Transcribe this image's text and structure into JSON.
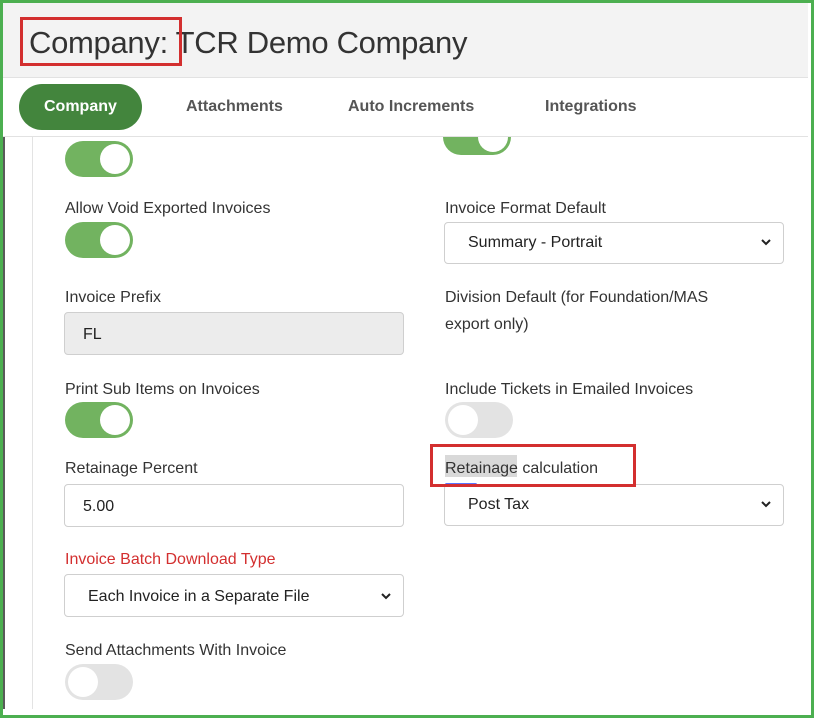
{
  "header": {
    "title": "Company: TCR Demo Company"
  },
  "tabs": [
    {
      "label": "Company",
      "active": true
    },
    {
      "label": "Attachments",
      "active": false
    },
    {
      "label": "Auto Increments",
      "active": false
    },
    {
      "label": "Integrations",
      "active": false
    }
  ],
  "fields": {
    "allow_void": {
      "label": "Allow Void Exported Invoices",
      "value": "on"
    },
    "invoice_format": {
      "label": "Invoice Format Default",
      "value": "Summary - Portrait"
    },
    "invoice_prefix": {
      "label": "Invoice Prefix",
      "value": "FL"
    },
    "division_default": {
      "label": "Division Default (for Foundation/MAS export only)",
      "line1": "Division Default (for Foundation/MAS",
      "line2": "export only)"
    },
    "print_sub_items": {
      "label": "Print Sub Items on Invoices",
      "value": "on"
    },
    "include_tickets": {
      "label": "Include Tickets in Emailed Invoices",
      "value": "off"
    },
    "retainage_percent": {
      "label": "Retainage Percent",
      "value": "5.00"
    },
    "retainage_calc": {
      "label": "Retainage calculation",
      "value": "Post Tax"
    },
    "batch_download": {
      "label": "Invoice Batch Download Type",
      "value": "Each Invoice in a Separate File"
    },
    "send_attachments": {
      "label": "Send Attachments With Invoice",
      "value": "off"
    }
  },
  "top_toggles": {
    "left": "on",
    "right": "on"
  },
  "icons": {
    "select_arrow": "chevron-down-icon"
  },
  "colors": {
    "accent": "#43853d",
    "toggle_on": "#72b360",
    "frame": "#4caf50",
    "highlight": "#d32f2f",
    "required_label": "#d32f2f"
  }
}
